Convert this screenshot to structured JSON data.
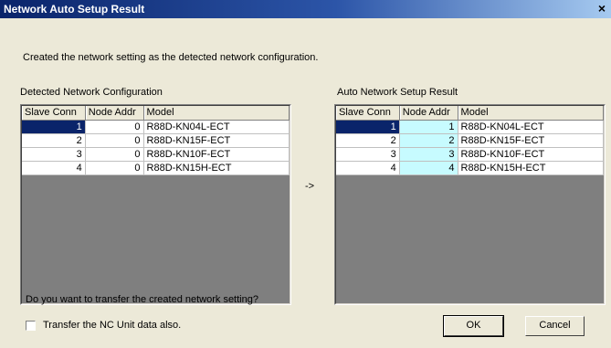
{
  "window": {
    "title": "Network Auto Setup Result",
    "close_glyph": "×"
  },
  "message": "Created the network setting as the detected network configuration.",
  "left_panel": {
    "label": "Detected Network Configuration",
    "headers": [
      "Slave Conn",
      "Node Addr",
      "Model"
    ],
    "rows": [
      [
        "1",
        "0",
        "R88D-KN04L-ECT"
      ],
      [
        "2",
        "0",
        "R88D-KN15F-ECT"
      ],
      [
        "3",
        "0",
        "R88D-KN10F-ECT"
      ],
      [
        "4",
        "0",
        "R88D-KN15H-ECT"
      ]
    ]
  },
  "arrow": "->",
  "right_panel": {
    "label": "Auto Network Setup Result",
    "headers": [
      "Slave Conn",
      "Node Addr",
      "Model"
    ],
    "rows": [
      [
        "1",
        "1",
        "R88D-KN04L-ECT"
      ],
      [
        "2",
        "2",
        "R88D-KN15F-ECT"
      ],
      [
        "3",
        "3",
        "R88D-KN10F-ECT"
      ],
      [
        "4",
        "4",
        "R88D-KN15H-ECT"
      ]
    ]
  },
  "question": "Do you want to transfer the created network setting?",
  "checkbox": {
    "label": "Transfer the NC Unit data also.",
    "checked": false
  },
  "buttons": {
    "ok": "OK",
    "cancel": "Cancel"
  },
  "colors": {
    "selection": "#0a246a",
    "highlight": "#c7fbff",
    "dialog_bg": "#ece9d8"
  }
}
